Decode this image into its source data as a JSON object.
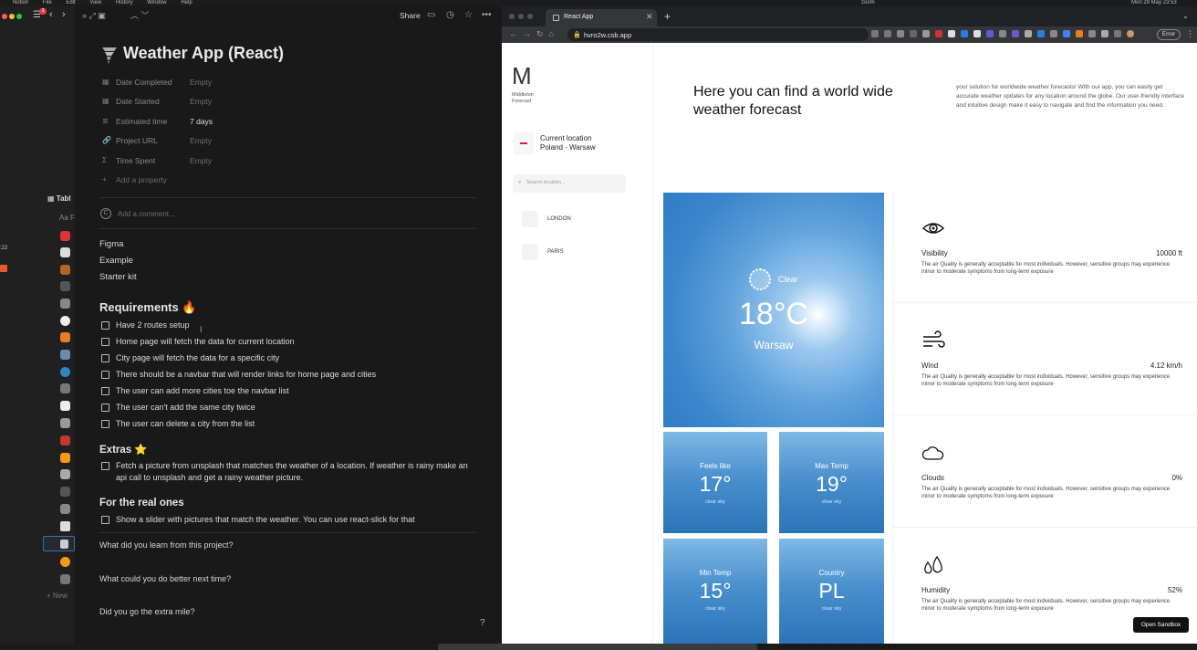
{
  "menubar": {
    "app": "Notion",
    "items": [
      "File",
      "Edit",
      "View",
      "History",
      "Window",
      "Help"
    ],
    "right": [
      "zoom",
      "Mon 29 May 23:53"
    ]
  },
  "notion": {
    "topbar": {
      "share": "Share",
      "badge": "3"
    },
    "sidebar": {
      "table_label": "Tabl",
      "aa_label": "Aa F",
      "time_label": ":22",
      "new_label": "+ New"
    },
    "page": {
      "icon": "tornado-icon",
      "title": "Weather App (React)",
      "properties": [
        {
          "icon": "calendar-icon",
          "label": "Date Completed",
          "value": "Empty",
          "filled": false
        },
        {
          "icon": "calendar-icon",
          "label": "Date Started",
          "value": "Empty",
          "filled": false
        },
        {
          "icon": "list-icon",
          "label": "Estimated time",
          "value": "7 days",
          "filled": true
        },
        {
          "icon": "link-icon",
          "label": "Project URL",
          "value": "Empty",
          "filled": false
        },
        {
          "icon": "sigma-icon",
          "label": "Time Spent",
          "value": "Empty",
          "filled": false
        }
      ],
      "add_property": "Add a property",
      "comment_placeholder": "Add a comment...",
      "links": [
        "Figma",
        "Example",
        "Starter kit"
      ],
      "requirements_heading": "Requirements 🔥",
      "requirements": [
        "Have 2 routes setup",
        "Home page will fetch the data for current location",
        "City page will fetch the data for a specific city",
        "There should be a navbar that will render links for home page and cities",
        "The user can add more cities toe the navbar list",
        "The user can't add the same city twice",
        "The user can delete a city from the list"
      ],
      "extras_heading": "Extras ⭐",
      "extras_item": "Fetch a picture from unsplash that matches the weather of a location. If weather is rainy make an api call to unsplash and get a rainy weather picture.",
      "real_heading": "For the real ones",
      "real_item": "Show a slider with pictures that match the weather. You can use react-slick for that",
      "questions": [
        "What did you learn from this project?",
        "What could you do better next time?",
        "Did you go the extra mile?"
      ],
      "help": "?"
    }
  },
  "browser": {
    "tab_title": "React App",
    "url": "hvro2w.csb.app",
    "error_label": "Error",
    "site": {
      "logo_letter": "M",
      "logo_text": [
        "Middleton",
        "Forecast"
      ],
      "current_location_label": "Current location",
      "current_location_value": "Poland - Warsaw",
      "search_placeholder": "Search location...",
      "cities": [
        "LONDON",
        "PARIS"
      ],
      "headline": "Here you can find a world wide weather forecast",
      "intro": "your solution for worldwide weather forecasts! With our app, you can easily get accurate weather updates for any location around the globe. Our user-friendly interface and intuitive design make it easy to navigate and find the information you need.",
      "main": {
        "condition": "Clear",
        "temp": "18°C",
        "city": "Warsaw"
      },
      "tiles": [
        {
          "label": "Feels like",
          "value": "17°",
          "sub": "clear sky"
        },
        {
          "label": "Max Temp",
          "value": "19°",
          "sub": "clear sky"
        },
        {
          "label": "Min Temp",
          "value": "15°",
          "sub": "clear sky"
        },
        {
          "label": "Country",
          "value": "PL",
          "sub": "clear sky"
        }
      ],
      "cards": [
        {
          "icon": "eye-icon",
          "name": "Visibility",
          "value": "10000 ft",
          "desc": "The air Quality is generally acceptable for most individuals. However, sensitive groups may experience minor to moderate symptoms from long-term exposure"
        },
        {
          "icon": "wind-icon",
          "name": "Wind",
          "value": "4.12 km/h",
          "desc": "The air Quality is generally acceptable for most individuals. However, sensitive groups may experience minor to moderate symptoms from long-term exposure"
        },
        {
          "icon": "cloud-icon",
          "name": "Clouds",
          "value": "0%",
          "desc": "The air Quality is generally acceptable for most individuals. However, sensitive groups may experience minor to moderate symptoms from long-term exposure"
        },
        {
          "icon": "droplets-icon",
          "name": "Humidity",
          "value": "52%",
          "desc": "The air Quality is generally acceptable for most individuals. However, sensitive groups may experience minor to moderate symptoms from long-term exposure"
        }
      ],
      "open_sandbox": "Open Sandbox"
    }
  }
}
